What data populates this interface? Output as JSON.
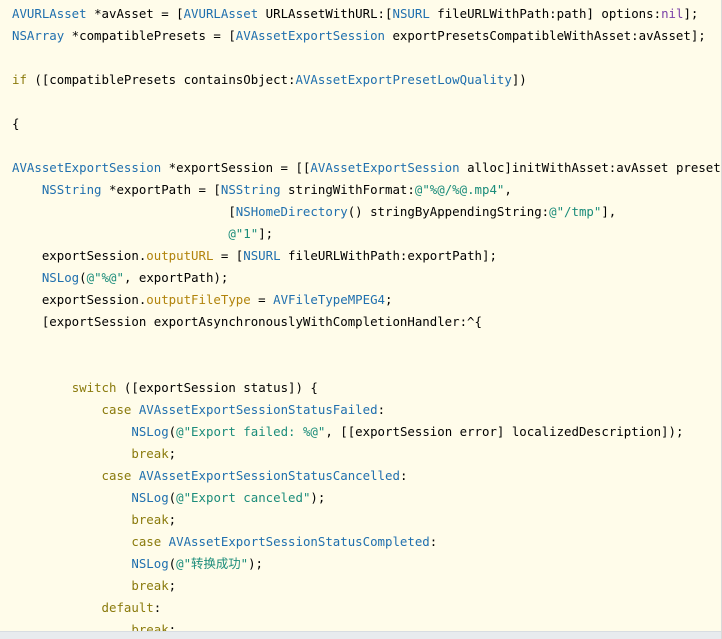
{
  "editor": {
    "lines": [
      {
        "tokens": [
          {
            "t": "AVURLAsset",
            "c": "type"
          },
          {
            "t": " *avAsset = [",
            "c": "plain"
          },
          {
            "t": "AVURLAsset",
            "c": "type"
          },
          {
            "t": " URLAssetWithURL:[",
            "c": "plain"
          },
          {
            "t": "NSURL",
            "c": "type"
          },
          {
            "t": " fileURLWithPath:path] options:",
            "c": "plain"
          },
          {
            "t": "nil",
            "c": "macro"
          },
          {
            "t": "];",
            "c": "plain"
          }
        ]
      },
      {
        "tokens": [
          {
            "t": "NSArray",
            "c": "type"
          },
          {
            "t": " *compatiblePresets = [",
            "c": "plain"
          },
          {
            "t": "AVAssetExportSession",
            "c": "type"
          },
          {
            "t": " exportPresetsCompatibleWithAsset:avAsset];",
            "c": "plain"
          }
        ]
      },
      {
        "tokens": []
      },
      {
        "tokens": [
          {
            "t": "if",
            "c": "kw"
          },
          {
            "t": " ([compatiblePresets containsObject:",
            "c": "plain"
          },
          {
            "t": "AVAssetExportPresetLowQuality",
            "c": "type"
          },
          {
            "t": "])",
            "c": "plain"
          }
        ]
      },
      {
        "tokens": []
      },
      {
        "tokens": [
          {
            "t": "{",
            "c": "plain"
          }
        ]
      },
      {
        "tokens": []
      },
      {
        "tokens": [
          {
            "t": "AVAssetExportSession",
            "c": "type"
          },
          {
            "t": " *exportSession = [[",
            "c": "plain"
          },
          {
            "t": "AVAssetExportSession",
            "c": "type"
          },
          {
            "t": " alloc]initWithAsset:avAsset presetN",
            "c": "plain"
          }
        ]
      },
      {
        "tokens": [
          {
            "t": "    ",
            "c": "plain"
          },
          {
            "t": "NSString",
            "c": "type"
          },
          {
            "t": " *exportPath = [",
            "c": "plain"
          },
          {
            "t": "NSString",
            "c": "type"
          },
          {
            "t": " stringWithFormat:",
            "c": "plain"
          },
          {
            "t": "@\"%@/%@.mp4\"",
            "c": "str"
          },
          {
            "t": ",",
            "c": "plain"
          }
        ]
      },
      {
        "tokens": [
          {
            "t": "                             [",
            "c": "plain"
          },
          {
            "t": "NSHomeDirectory",
            "c": "type"
          },
          {
            "t": "() stringByAppendingString:",
            "c": "plain"
          },
          {
            "t": "@\"/tmp\"",
            "c": "str"
          },
          {
            "t": "],",
            "c": "plain"
          }
        ]
      },
      {
        "tokens": [
          {
            "t": "                             ",
            "c": "plain"
          },
          {
            "t": "@\"1\"",
            "c": "str"
          },
          {
            "t": "];",
            "c": "plain"
          }
        ]
      },
      {
        "tokens": [
          {
            "t": "    exportSession.",
            "c": "plain"
          },
          {
            "t": "outputURL",
            "c": "prop"
          },
          {
            "t": " = [",
            "c": "plain"
          },
          {
            "t": "NSURL",
            "c": "type"
          },
          {
            "t": " fileURLWithPath:exportPath];",
            "c": "plain"
          }
        ]
      },
      {
        "tokens": [
          {
            "t": "    ",
            "c": "plain"
          },
          {
            "t": "NSLog",
            "c": "type"
          },
          {
            "t": "(",
            "c": "plain"
          },
          {
            "t": "@\"%@\"",
            "c": "str"
          },
          {
            "t": ", exportPath);",
            "c": "plain"
          }
        ]
      },
      {
        "tokens": [
          {
            "t": "    exportSession.",
            "c": "plain"
          },
          {
            "t": "outputFileType",
            "c": "prop"
          },
          {
            "t": " = ",
            "c": "plain"
          },
          {
            "t": "AVFileTypeMPEG4",
            "c": "type"
          },
          {
            "t": ";",
            "c": "plain"
          }
        ]
      },
      {
        "tokens": [
          {
            "t": "    [exportSession exportAsynchronouslyWithCompletionHandler:^{",
            "c": "plain"
          }
        ]
      },
      {
        "tokens": []
      },
      {
        "tokens": []
      },
      {
        "tokens": [
          {
            "t": "        ",
            "c": "plain"
          },
          {
            "t": "switch",
            "c": "kw"
          },
          {
            "t": " ([exportSession status]) {",
            "c": "plain"
          }
        ]
      },
      {
        "tokens": [
          {
            "t": "            ",
            "c": "plain"
          },
          {
            "t": "case",
            "c": "kw"
          },
          {
            "t": " ",
            "c": "plain"
          },
          {
            "t": "AVAssetExportSessionStatusFailed",
            "c": "type"
          },
          {
            "t": ":",
            "c": "plain"
          }
        ]
      },
      {
        "tokens": [
          {
            "t": "                ",
            "c": "plain"
          },
          {
            "t": "NSLog",
            "c": "type"
          },
          {
            "t": "(",
            "c": "plain"
          },
          {
            "t": "@\"Export failed: %@\"",
            "c": "str"
          },
          {
            "t": ", [[exportSession error] localizedDescription]);",
            "c": "plain"
          }
        ]
      },
      {
        "tokens": [
          {
            "t": "                ",
            "c": "plain"
          },
          {
            "t": "break",
            "c": "kw"
          },
          {
            "t": ";",
            "c": "plain"
          }
        ]
      },
      {
        "tokens": [
          {
            "t": "            ",
            "c": "plain"
          },
          {
            "t": "case",
            "c": "kw"
          },
          {
            "t": " ",
            "c": "plain"
          },
          {
            "t": "AVAssetExportSessionStatusCancelled",
            "c": "type"
          },
          {
            "t": ":",
            "c": "plain"
          }
        ]
      },
      {
        "tokens": [
          {
            "t": "                ",
            "c": "plain"
          },
          {
            "t": "NSLog",
            "c": "type"
          },
          {
            "t": "(",
            "c": "plain"
          },
          {
            "t": "@\"Export canceled\"",
            "c": "str"
          },
          {
            "t": ");",
            "c": "plain"
          }
        ]
      },
      {
        "tokens": [
          {
            "t": "                ",
            "c": "plain"
          },
          {
            "t": "break",
            "c": "kw"
          },
          {
            "t": ";",
            "c": "plain"
          }
        ]
      },
      {
        "tokens": [
          {
            "t": "                ",
            "c": "plain"
          },
          {
            "t": "case",
            "c": "kw"
          },
          {
            "t": " ",
            "c": "plain"
          },
          {
            "t": "AVAssetExportSessionStatusCompleted",
            "c": "type"
          },
          {
            "t": ":",
            "c": "plain"
          }
        ]
      },
      {
        "tokens": [
          {
            "t": "                ",
            "c": "plain"
          },
          {
            "t": "NSLog",
            "c": "type"
          },
          {
            "t": "(",
            "c": "plain"
          },
          {
            "t": "@\"转换成功\"",
            "c": "str"
          },
          {
            "t": ");",
            "c": "plain"
          }
        ]
      },
      {
        "tokens": [
          {
            "t": "                ",
            "c": "plain"
          },
          {
            "t": "break",
            "c": "kw"
          },
          {
            "t": ";",
            "c": "plain"
          }
        ]
      },
      {
        "tokens": [
          {
            "t": "            ",
            "c": "plain"
          },
          {
            "t": "default",
            "c": "kw"
          },
          {
            "t": ":",
            "c": "plain"
          }
        ]
      },
      {
        "tokens": [
          {
            "t": "                ",
            "c": "plain"
          },
          {
            "t": "break",
            "c": "kw"
          },
          {
            "t": ";",
            "c": "plain"
          }
        ]
      },
      {
        "tokens": [
          {
            "t": "        }",
            "c": "plain"
          }
        ]
      }
    ]
  },
  "theme": {
    "background": "#fffcea",
    "type_color": "#1f6fae",
    "string_color": "#1b8c7a",
    "keyword_color": "#8a7a0c",
    "property_color": "#b1830b",
    "macro_color": "#7a40a7",
    "plain_color": "#000000"
  }
}
